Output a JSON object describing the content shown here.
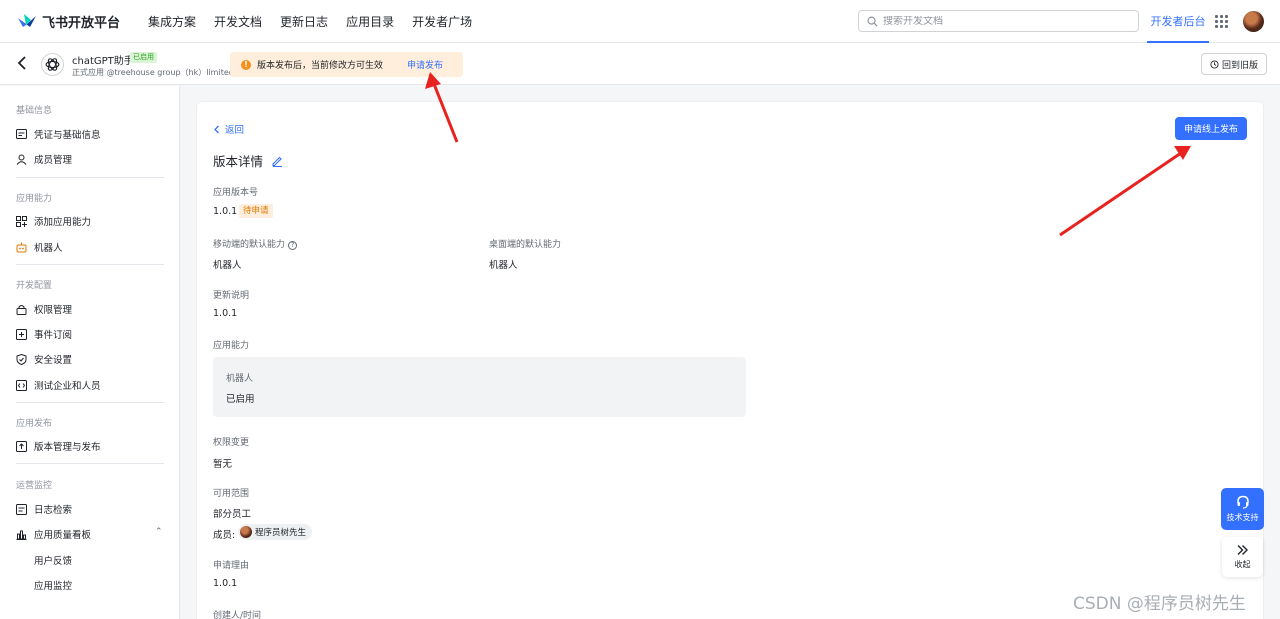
{
  "topnav": {
    "logo_text": "飞书开放平台",
    "links": [
      "集成方案",
      "开发文档",
      "更新日志",
      "应用目录",
      "开发者广场"
    ],
    "search_placeholder": "搜索开发文档",
    "dev_console": "开发者后台",
    "accent": "#3370ff"
  },
  "appbar": {
    "app_name": "chatGPT助手",
    "app_badge": "已启用",
    "app_sub": "正式应用 @treehouse group（hk）limited",
    "notice_text": "版本发布后，当前修改方可生效",
    "notice_link": "申请发布",
    "old_version": "回到旧版"
  },
  "sidebar": {
    "groups": [
      {
        "title": "基础信息",
        "items": [
          "凭证与基础信息",
          "成员管理"
        ]
      },
      {
        "title": "应用能力",
        "items": [
          "添加应用能力",
          "机器人"
        ]
      },
      {
        "title": "开发配置",
        "items": [
          "权限管理",
          "事件订阅",
          "安全设置",
          "测试企业和人员"
        ]
      },
      {
        "title": "应用发布",
        "items": [
          "版本管理与发布"
        ]
      },
      {
        "title": "运营监控",
        "items": [
          "日志检索",
          "应用质量看板"
        ]
      }
    ],
    "sub_items": [
      "用户反馈",
      "应用监控"
    ]
  },
  "main": {
    "back": "返回",
    "title": "版本详情",
    "publish_button": "申请线上发布",
    "version_label": "应用版本号",
    "version_value": "1.0.1",
    "status_tag": "待申请",
    "mobile_label": "移动端的默认能力",
    "mobile_value": "机器人",
    "desktop_label": "桌面端的默认能力",
    "desktop_value": "机器人",
    "changelog_label": "更新说明",
    "changelog_value": "1.0.1",
    "capability_label": "应用能力",
    "capability_name": "机器人",
    "capability_status": "已启用",
    "permission_label": "权限变更",
    "permission_value": "暂无",
    "scope_label": "可用范围",
    "scope_value": "部分员工",
    "member_label": "成员:",
    "member_name": "程序员树先生",
    "reason_label": "申请理由",
    "reason_value": "1.0.1",
    "creator_label": "创建人/时间"
  },
  "floating": {
    "support": "技术支持",
    "collapse": "收起"
  },
  "watermark": "CSDN @程序员树先生",
  "annotation_color": "#e8231f"
}
